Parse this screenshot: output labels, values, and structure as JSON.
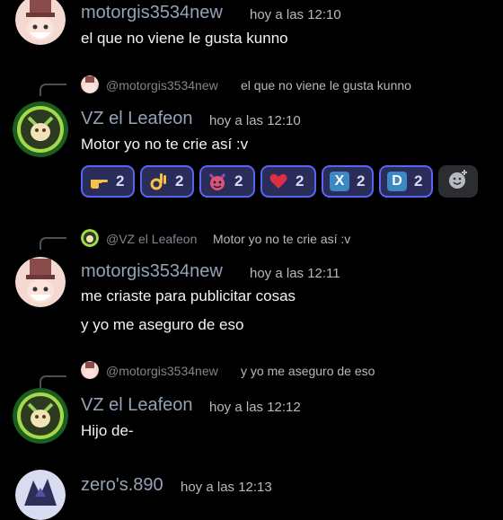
{
  "messages": [
    {
      "author": "motorgis3534new",
      "timestamp": "hoy a las 12:10",
      "lines": [
        "el que no viene le gusta kunno"
      ]
    },
    {
      "reply": {
        "author": "@motorgis3534new",
        "text": "el que no viene le gusta kunno"
      },
      "author": "VZ el Leafeon",
      "timestamp": "hoy a las 12:10",
      "lines": [
        "Motor yo no te crie así :v"
      ],
      "reactions": [
        {
          "emoji": "pointing-hand-icon",
          "count": "2"
        },
        {
          "emoji": "ok-hand-icon",
          "count": "2"
        },
        {
          "emoji": "devil-face-icon",
          "count": "2"
        },
        {
          "emoji": "heart-icon",
          "count": "2"
        },
        {
          "emoji": "x-letter-icon",
          "letter": "X",
          "count": "2"
        },
        {
          "emoji": "d-letter-icon",
          "letter": "D",
          "count": "2"
        }
      ]
    },
    {
      "reply": {
        "author": "@VZ el Leafeon",
        "text": "Motor yo no te crie así :v"
      },
      "author": "motorgis3534new",
      "timestamp": "hoy a las 12:11",
      "lines": [
        "me criaste para publicitar cosas",
        "y yo me aseguro de eso"
      ]
    },
    {
      "reply": {
        "author": "@motorgis3534new",
        "text": "y yo me aseguro de eso"
      },
      "author": "VZ el Leafeon",
      "timestamp": "hoy a las 12:12",
      "lines": [
        "Hijo de-"
      ]
    },
    {
      "author": "zero's.890",
      "timestamp": "hoy a las 12:13",
      "lines": []
    }
  ],
  "colors": {
    "background": "#000000",
    "author_name": "#93a3b8",
    "reaction_bg": "#2a2c5a",
    "reaction_border": "#5865f2"
  }
}
